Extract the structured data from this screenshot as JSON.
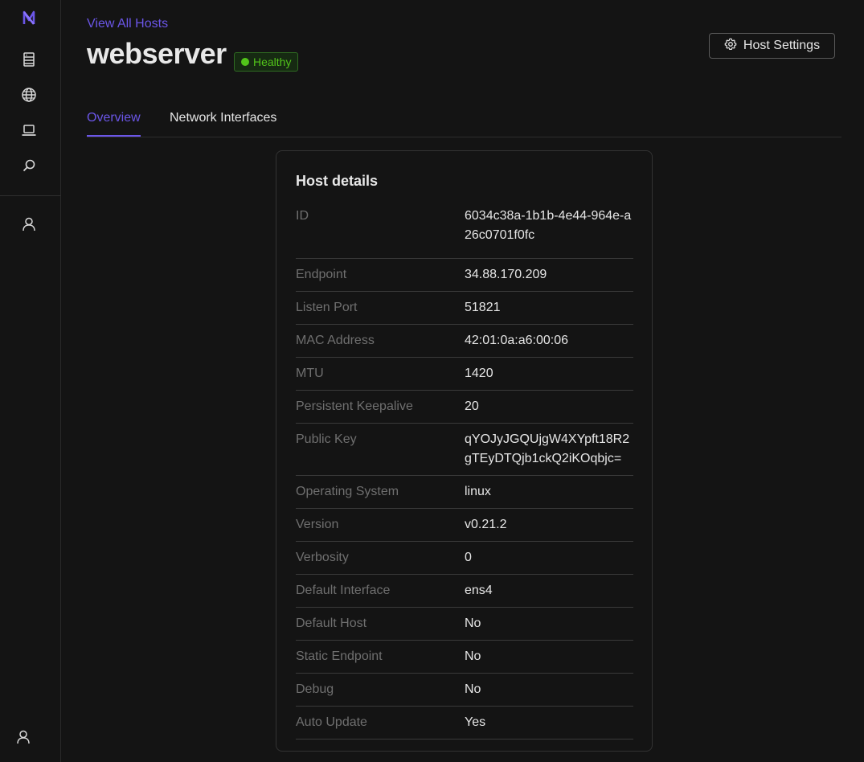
{
  "sidebar": {
    "logo": "N",
    "icons": [
      "hosts-icon",
      "globe-icon",
      "laptop-icon",
      "search-icon",
      "user-icon"
    ],
    "bottom_icon": "user-icon"
  },
  "header": {
    "back_link": "View All Hosts",
    "title": "webserver",
    "status": "Healthy",
    "settings_label": "Host Settings"
  },
  "tabs": [
    {
      "label": "Overview",
      "active": true
    },
    {
      "label": "Network Interfaces",
      "active": false
    }
  ],
  "card": {
    "title": "Host details",
    "rows": [
      {
        "key": "ID",
        "value": "6034c38a-1b1b-4e44-964e-a26c0701f0fc"
      },
      {
        "key": "Endpoint",
        "value": "34.88.170.209"
      },
      {
        "key": "Listen Port",
        "value": "51821"
      },
      {
        "key": "MAC Address",
        "value": "42:01:0a:a6:00:06"
      },
      {
        "key": "MTU",
        "value": "1420"
      },
      {
        "key": "Persistent Keepalive",
        "value": "20"
      },
      {
        "key": "Public Key",
        "value": "qYOJyJGQUjgW4XYpft18R2gTEyDTQjb1ckQ2iKOqbjc="
      },
      {
        "key": "Operating System",
        "value": "linux"
      },
      {
        "key": "Version",
        "value": "v0.21.2"
      },
      {
        "key": "Verbosity",
        "value": "0"
      },
      {
        "key": "Default Interface",
        "value": "ens4"
      },
      {
        "key": "Default Host",
        "value": "No"
      },
      {
        "key": "Static Endpoint",
        "value": "No"
      },
      {
        "key": "Debug",
        "value": "No"
      },
      {
        "key": "Auto Update",
        "value": "Yes"
      }
    ]
  },
  "colors": {
    "accent": "#6b56e8",
    "healthy": "#52c41a",
    "background": "#141414"
  }
}
